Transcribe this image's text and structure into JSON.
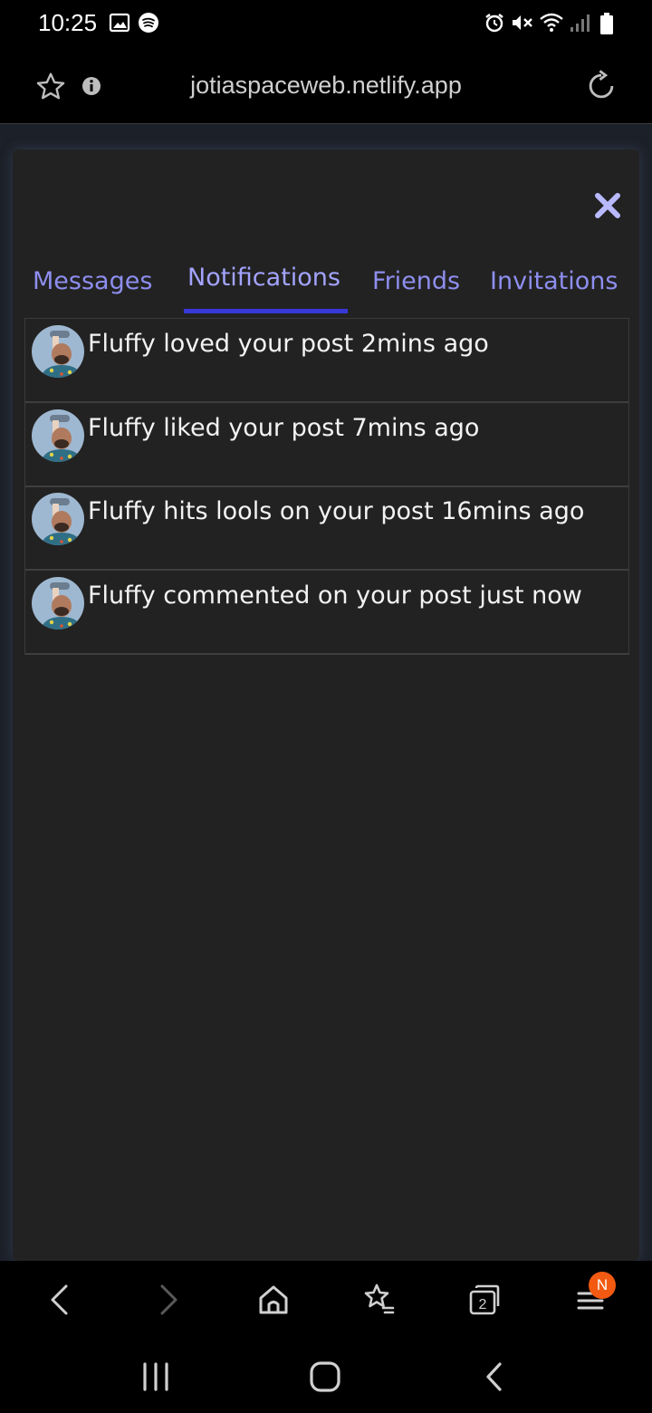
{
  "status_bar": {
    "time": "10:25",
    "left_icons": [
      "image-icon",
      "spotify-icon"
    ],
    "right_icons": [
      "alarm-icon",
      "mute-icon",
      "wifi-icon",
      "signal-icon",
      "battery-icon"
    ]
  },
  "browser": {
    "url": "jotiaspaceweb.netlify.app",
    "left_icons": [
      "star-icon",
      "info-icon"
    ],
    "right_icon": "reload-icon"
  },
  "modal": {
    "close_icon": "close-icon",
    "tabs": [
      {
        "label": "Messages",
        "active": false
      },
      {
        "label": "Notifications",
        "active": true
      },
      {
        "label": "Friends",
        "active": false
      },
      {
        "label": "Invitations",
        "active": false
      }
    ],
    "notifications": [
      {
        "text": "Fluffy loved your post 2mins ago"
      },
      {
        "text": "Fluffy liked your post 7mins ago"
      },
      {
        "text": "Fluffy hits lools on your post 16mins ago"
      },
      {
        "text": "Fluffy commented on your post just now"
      }
    ],
    "accent_color": "#3838d8",
    "tab_color": "#8e8ef0"
  },
  "bottom_nav": {
    "items": [
      "back-icon",
      "forward-icon",
      "home-icon",
      "bookmarks-icon",
      "tabs-icon",
      "menu-icon"
    ],
    "tab_count": "2",
    "menu_badge": "N",
    "badge_color": "#f25a11"
  },
  "system_nav": {
    "items": [
      "recents-icon",
      "home-button-icon",
      "back-button-icon"
    ]
  }
}
